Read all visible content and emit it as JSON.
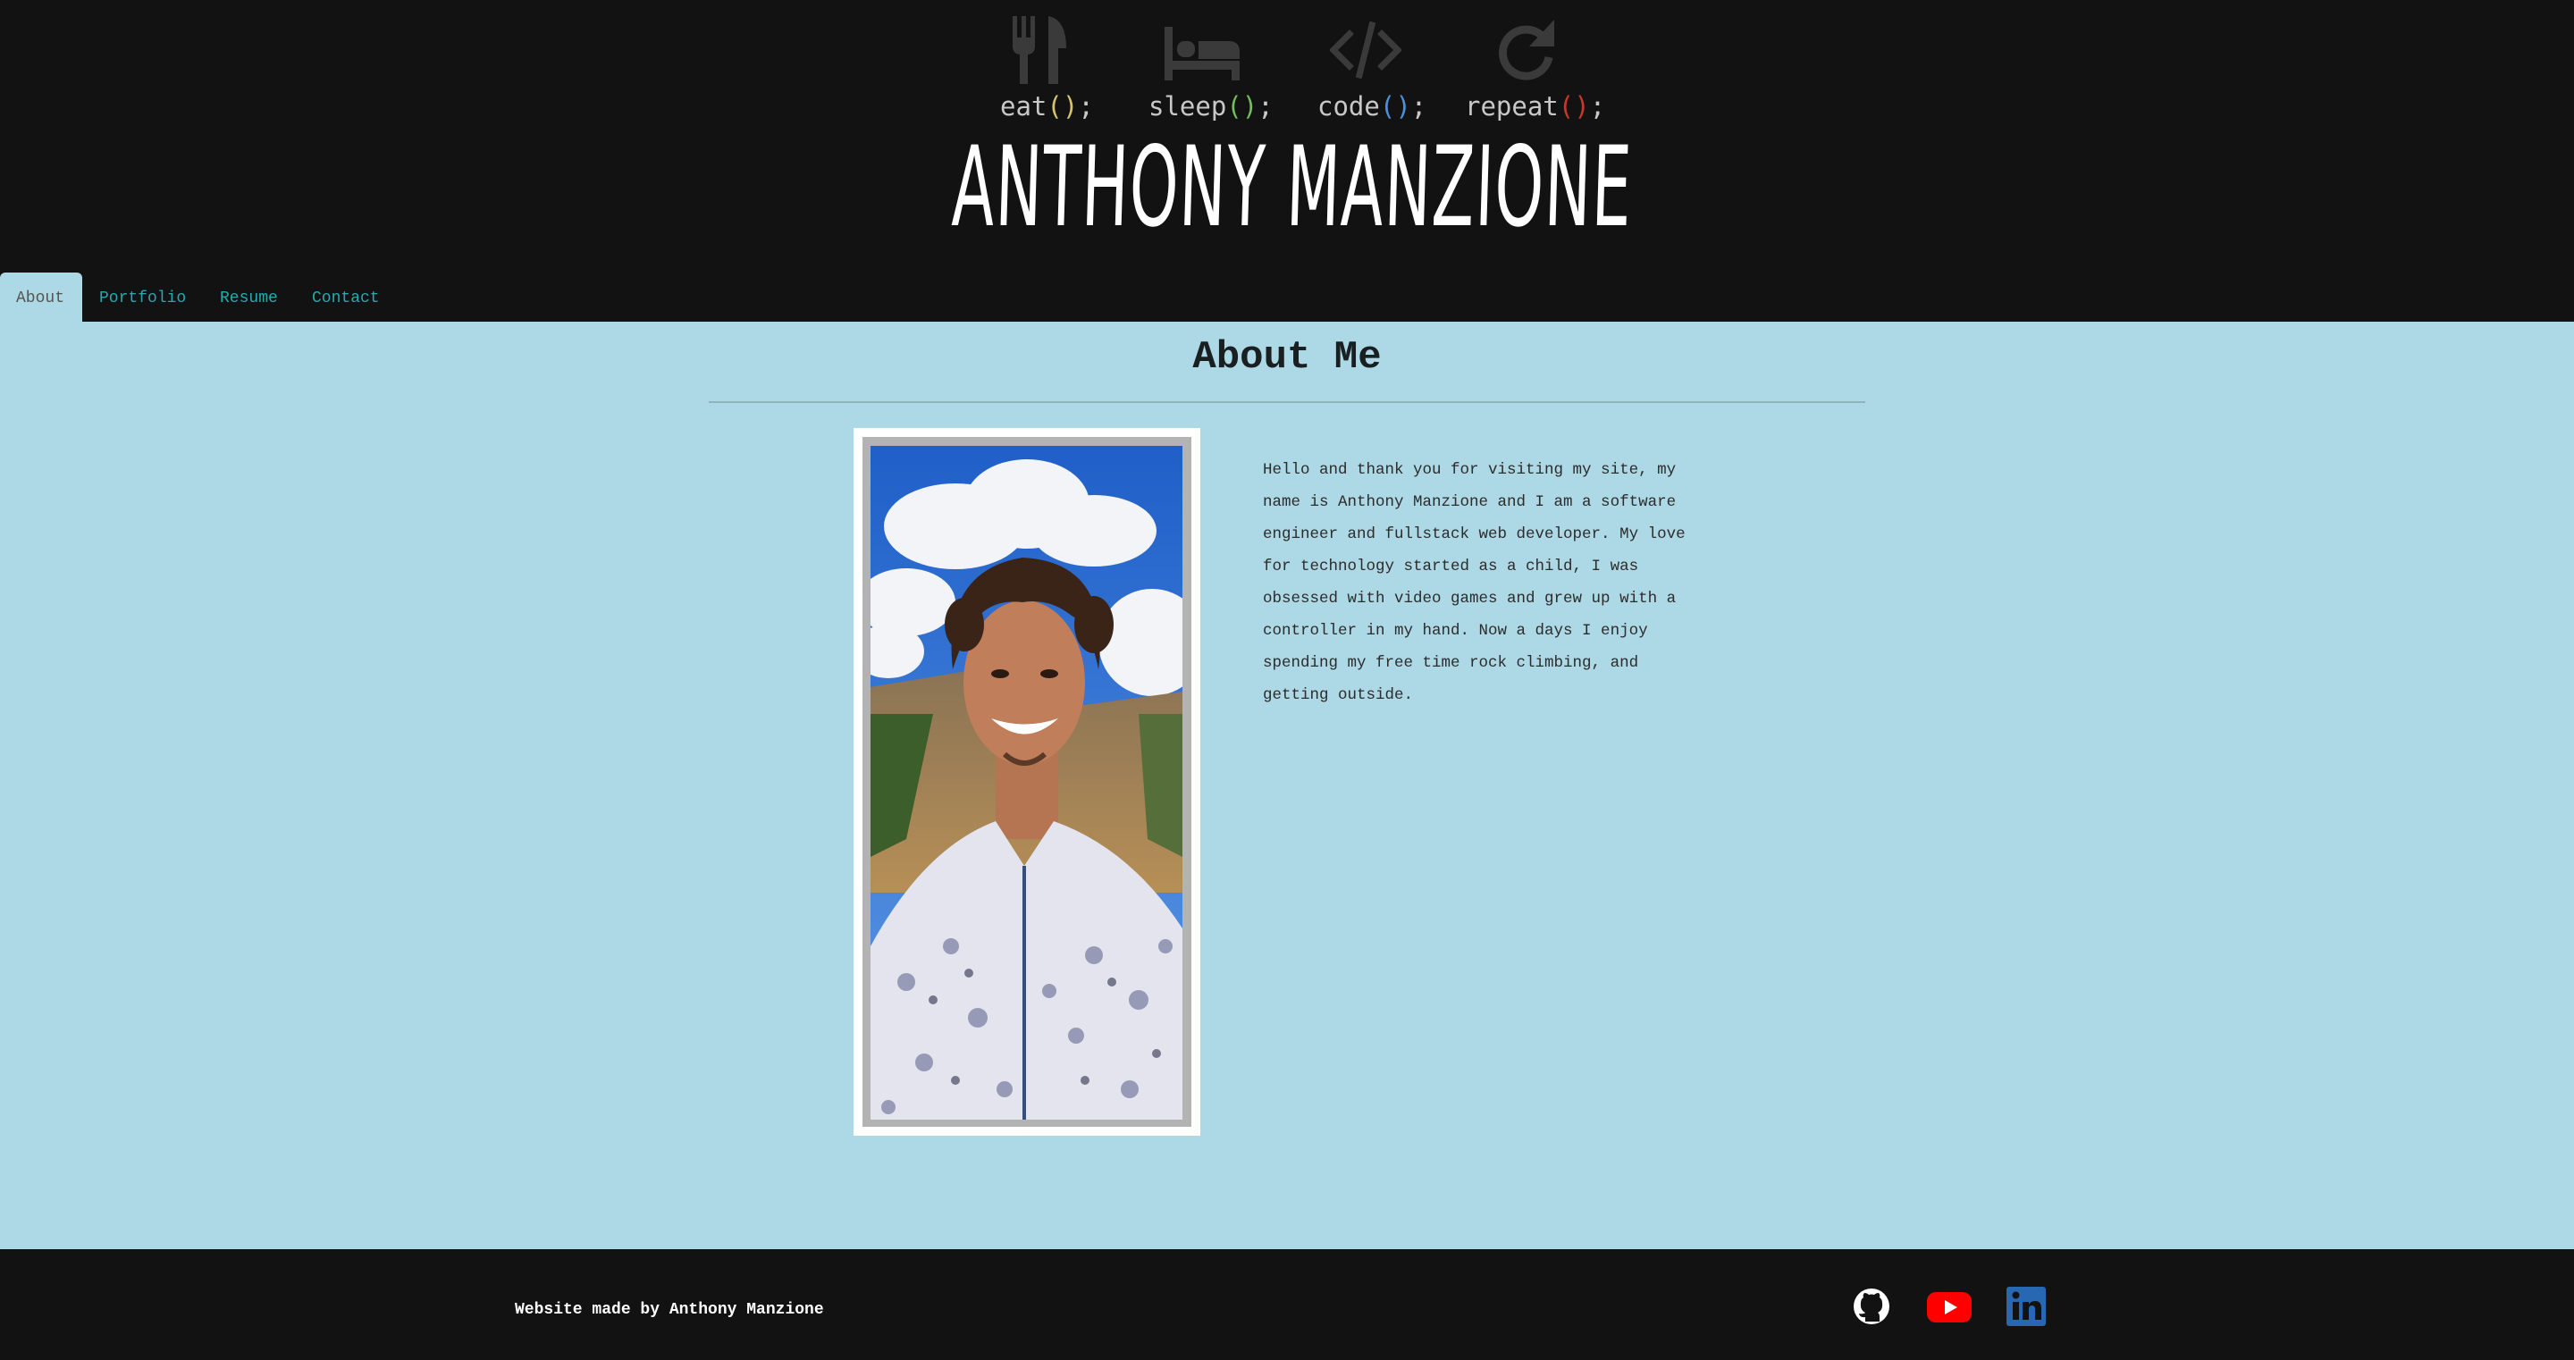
{
  "header": {
    "motto": [
      {
        "icon": "utensils-icon",
        "word": "eat",
        "open": "(",
        "close": ")",
        "semi": ";",
        "paren_color": "#d8c46a"
      },
      {
        "icon": "bed-icon",
        "word": "sleep",
        "open": "(",
        "close": ")",
        "semi": ";",
        "paren_color": "#6fbf5a"
      },
      {
        "icon": "code-icon",
        "word": "code",
        "open": "(",
        "close": ")",
        "semi": ";",
        "paren_color": "#4f8fd6"
      },
      {
        "icon": "redo-icon",
        "word": "repeat",
        "open": "(",
        "close": ")",
        "semi": ";",
        "paren_color": "#c9372c"
      }
    ],
    "site_title": "ANTHONY MANZIONE"
  },
  "nav": {
    "tabs": [
      {
        "label": "About",
        "active": true
      },
      {
        "label": "Portfolio",
        "active": false
      },
      {
        "label": "Resume",
        "active": false
      },
      {
        "label": "Contact",
        "active": false
      }
    ]
  },
  "main": {
    "heading": "About Me",
    "bio": "Hello and thank you for visiting my site, my name is Anthony Manzione and I am a software engineer and fullstack web developer. My love for technology started as a child, I was obsessed with video games and grew up with a controller in my hand. Now a days I enjoy spending my free time rock climbing, and getting outside."
  },
  "footer": {
    "credit": "Website made by Anthony Manzione",
    "social": [
      {
        "icon": "github-icon",
        "color": "#ffffff"
      },
      {
        "icon": "youtube-icon",
        "color": "#ff0000"
      },
      {
        "icon": "linkedin-icon",
        "color": "#2867b2"
      }
    ]
  },
  "colors": {
    "header_bg": "#121212",
    "page_bg": "#add8e6",
    "nav_link": "#28a9b0",
    "icon_gray": "#3a3a3a"
  }
}
